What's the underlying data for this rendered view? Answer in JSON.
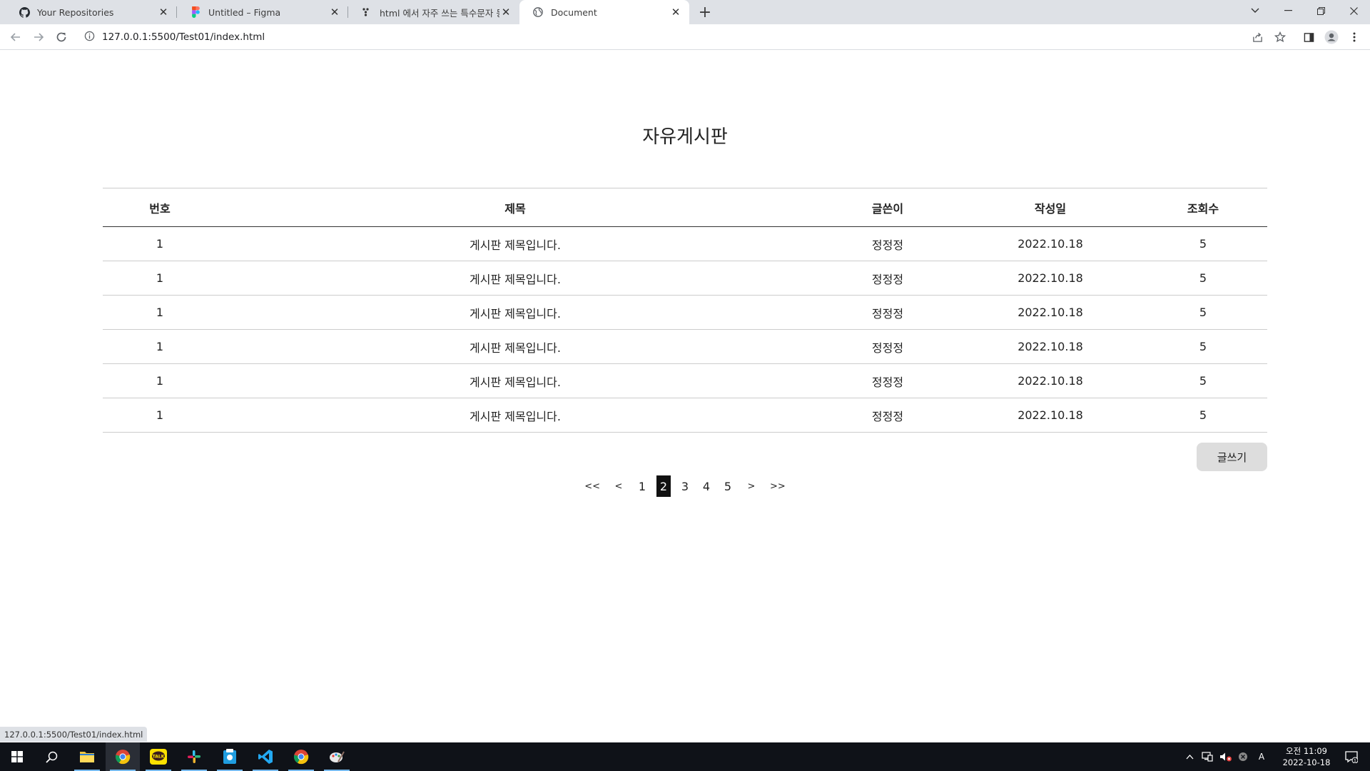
{
  "browser": {
    "tabs": [
      {
        "title": "Your Repositories",
        "icon": "github-icon"
      },
      {
        "title": "Untitled – Figma",
        "icon": "figma-icon"
      },
      {
        "title": "html 에서 자주 쓰는 특수문자 등",
        "icon": "velog-icon"
      },
      {
        "title": "Document",
        "icon": "globe-icon"
      }
    ],
    "url": "127.0.0.1:5500/Test01/index.html",
    "status_url": "127.0.0.1:5500/Test01/index.html"
  },
  "page": {
    "title": "자유게시판",
    "columns": [
      "번호",
      "제목",
      "글쓴이",
      "작성일",
      "조회수"
    ],
    "rows": [
      {
        "no": "1",
        "title": "게시판 제목입니다.",
        "writer": "정정정",
        "date": "2022.10.18",
        "views": "5"
      },
      {
        "no": "1",
        "title": "게시판 제목입니다.",
        "writer": "정정정",
        "date": "2022.10.18",
        "views": "5"
      },
      {
        "no": "1",
        "title": "게시판 제목입니다.",
        "writer": "정정정",
        "date": "2022.10.18",
        "views": "5"
      },
      {
        "no": "1",
        "title": "게시판 제목입니다.",
        "writer": "정정정",
        "date": "2022.10.18",
        "views": "5"
      },
      {
        "no": "1",
        "title": "게시판 제목입니다.",
        "writer": "정정정",
        "date": "2022.10.18",
        "views": "5"
      },
      {
        "no": "1",
        "title": "게시판 제목입니다.",
        "writer": "정정정",
        "date": "2022.10.18",
        "views": "5"
      }
    ],
    "write_button": "글쓰기",
    "pagination": {
      "first": "<<",
      "prev": "<",
      "pages": [
        "1",
        "2",
        "3",
        "4",
        "5"
      ],
      "current": "2",
      "next": ">",
      "last": ">>"
    }
  },
  "taskbar": {
    "apps": [
      "file-explorer-icon",
      "chrome-icon",
      "kakaotalk-icon",
      "slack-icon",
      "app-icon",
      "vscode-icon",
      "chrome-icon",
      "paint-icon"
    ],
    "clock_period": "오전 11:09",
    "clock_date": "2022-10-18",
    "ime": "A",
    "notification_count": "1"
  },
  "colors": {
    "tabstrip": "#dee1e6",
    "taskbar": "#0f1218",
    "current_page": "#111111",
    "write_button": "#dddddd"
  }
}
